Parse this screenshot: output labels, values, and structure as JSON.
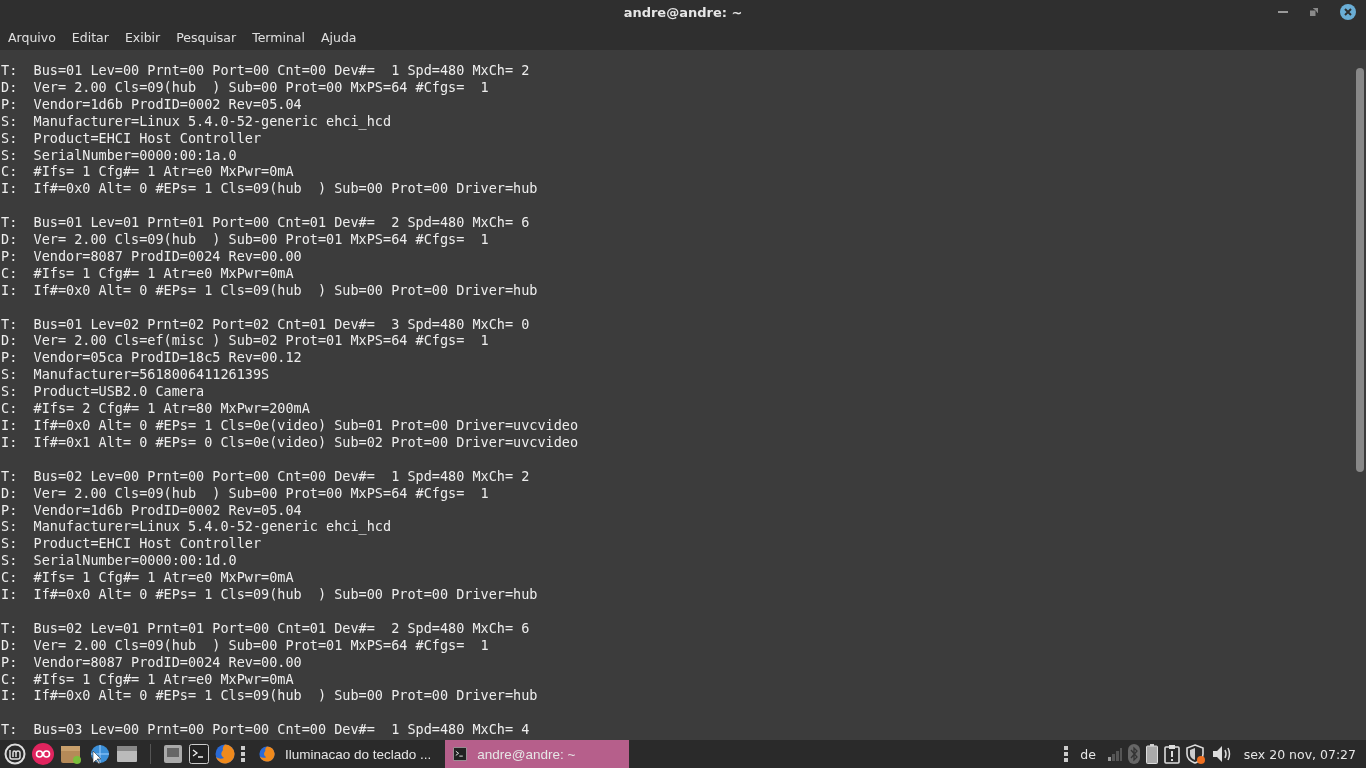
{
  "window": {
    "title": "andre@andre: ~"
  },
  "menu": [
    "Arquivo",
    "Editar",
    "Exibir",
    "Pesquisar",
    "Terminal",
    "Ajuda"
  ],
  "terminal": {
    "blocks": [
      [
        "T:  Bus=01 Lev=00 Prnt=00 Port=00 Cnt=00 Dev#=  1 Spd=480 MxCh= 2",
        "D:  Ver= 2.00 Cls=09(hub  ) Sub=00 Prot=00 MxPS=64 #Cfgs=  1",
        "P:  Vendor=1d6b ProdID=0002 Rev=05.04",
        "S:  Manufacturer=Linux 5.4.0-52-generic ehci_hcd",
        "S:  Product=EHCI Host Controller",
        "S:  SerialNumber=0000:00:1a.0",
        "C:  #Ifs= 1 Cfg#= 1 Atr=e0 MxPwr=0mA",
        "I:  If#=0x0 Alt= 0 #EPs= 1 Cls=09(hub  ) Sub=00 Prot=00 Driver=hub"
      ],
      [
        "T:  Bus=01 Lev=01 Prnt=01 Port=00 Cnt=01 Dev#=  2 Spd=480 MxCh= 6",
        "D:  Ver= 2.00 Cls=09(hub  ) Sub=00 Prot=01 MxPS=64 #Cfgs=  1",
        "P:  Vendor=8087 ProdID=0024 Rev=00.00",
        "C:  #Ifs= 1 Cfg#= 1 Atr=e0 MxPwr=0mA",
        "I:  If#=0x0 Alt= 0 #EPs= 1 Cls=09(hub  ) Sub=00 Prot=00 Driver=hub"
      ],
      [
        "T:  Bus=01 Lev=02 Prnt=02 Port=02 Cnt=01 Dev#=  3 Spd=480 MxCh= 0",
        "D:  Ver= 2.00 Cls=ef(misc ) Sub=02 Prot=01 MxPS=64 #Cfgs=  1",
        "P:  Vendor=05ca ProdID=18c5 Rev=00.12",
        "S:  Manufacturer=561800641126139S",
        "S:  Product=USB2.0 Camera",
        "C:  #Ifs= 2 Cfg#= 1 Atr=80 MxPwr=200mA",
        "I:  If#=0x0 Alt= 0 #EPs= 1 Cls=0e(video) Sub=01 Prot=00 Driver=uvcvideo",
        "I:  If#=0x1 Alt= 0 #EPs= 0 Cls=0e(video) Sub=02 Prot=00 Driver=uvcvideo"
      ],
      [
        "T:  Bus=02 Lev=00 Prnt=00 Port=00 Cnt=00 Dev#=  1 Spd=480 MxCh= 2",
        "D:  Ver= 2.00 Cls=09(hub  ) Sub=00 Prot=00 MxPS=64 #Cfgs=  1",
        "P:  Vendor=1d6b ProdID=0002 Rev=05.04",
        "S:  Manufacturer=Linux 5.4.0-52-generic ehci_hcd",
        "S:  Product=EHCI Host Controller",
        "S:  SerialNumber=0000:00:1d.0",
        "C:  #Ifs= 1 Cfg#= 1 Atr=e0 MxPwr=0mA",
        "I:  If#=0x0 Alt= 0 #EPs= 1 Cls=09(hub  ) Sub=00 Prot=00 Driver=hub"
      ],
      [
        "T:  Bus=02 Lev=01 Prnt=01 Port=00 Cnt=01 Dev#=  2 Spd=480 MxCh= 6",
        "D:  Ver= 2.00 Cls=09(hub  ) Sub=00 Prot=01 MxPS=64 #Cfgs=  1",
        "P:  Vendor=8087 ProdID=0024 Rev=00.00",
        "C:  #Ifs= 1 Cfg#= 1 Atr=e0 MxPwr=0mA",
        "I:  If#=0x0 Alt= 0 #EPs= 1 Cls=09(hub  ) Sub=00 Prot=00 Driver=hub"
      ],
      [
        "T:  Bus=03 Lev=00 Prnt=00 Port=00 Cnt=00 Dev#=  1 Spd=480 MxCh= 4"
      ]
    ]
  },
  "taskbar": {
    "tasks": [
      {
        "kind": "browser",
        "label": "Iluminacao do teclado ...",
        "selected": false
      },
      {
        "kind": "terminal",
        "label": "andre@andre: ~",
        "selected": true
      }
    ],
    "keyboard_layout": "de",
    "clock": "sex 20 nov, 07:27"
  }
}
